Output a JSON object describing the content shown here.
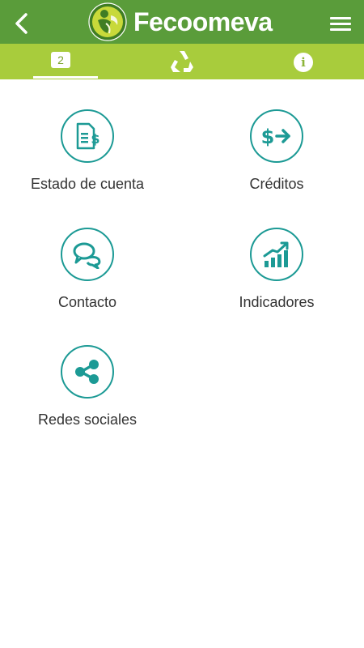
{
  "header": {
    "brand_name": "Fecoomeva",
    "icons": {
      "back": "chevron-left-icon",
      "logo": "fecoomeva-logo",
      "menu": "hamburger-menu-icon"
    },
    "colors": {
      "app_bar": "#5a9c3a",
      "tab_bar": "#a8cc3c",
      "accent": "#1c9a95"
    }
  },
  "tabs": [
    {
      "badge": "2",
      "icon": "notification-badge-icon",
      "active": true
    },
    {
      "icon": "recycle-triangle-icon",
      "active": false
    },
    {
      "glyph": "i",
      "icon": "info-icon",
      "active": false
    }
  ],
  "menu": [
    {
      "label": "Estado de cuenta",
      "icon": "account-statement-icon"
    },
    {
      "label": "Créditos",
      "icon": "credit-transfer-icon"
    },
    {
      "label": "Contacto",
      "icon": "chat-bubbles-icon"
    },
    {
      "label": "Indicadores",
      "icon": "bar-chart-growth-icon"
    },
    {
      "label": "Redes sociales",
      "icon": "share-icon"
    }
  ]
}
